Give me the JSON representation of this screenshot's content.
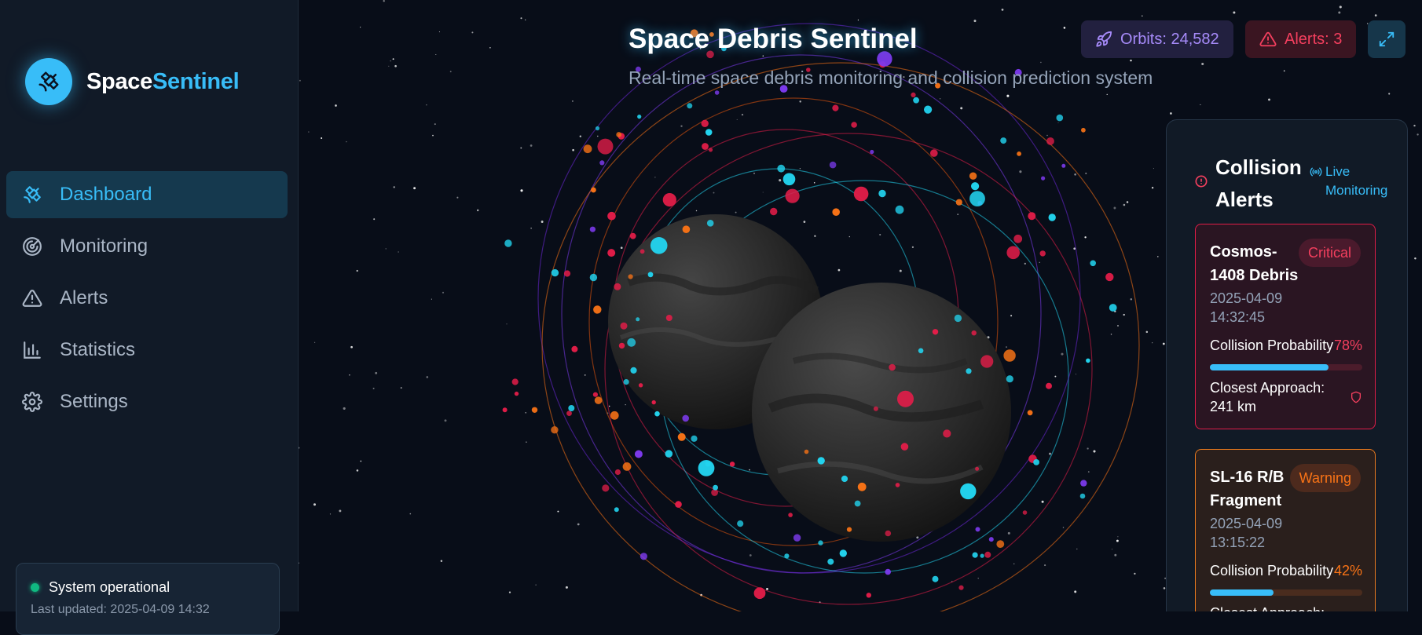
{
  "brand": {
    "name_part1": "Space",
    "name_part2": "Sentinel",
    "logo_icon": "satellite-icon"
  },
  "nav": [
    {
      "label": "Dashboard",
      "icon": "satellite-icon",
      "active": true
    },
    {
      "label": "Monitoring",
      "icon": "radar-icon",
      "active": false
    },
    {
      "label": "Alerts",
      "icon": "warning-icon",
      "active": false
    },
    {
      "label": "Statistics",
      "icon": "bar-chart-icon",
      "active": false
    },
    {
      "label": "Settings",
      "icon": "gear-icon",
      "active": false
    }
  ],
  "status": {
    "text": "System operational",
    "updated": "Last updated: 2025-04-09 14:32"
  },
  "header": {
    "title": "Space Debris Sentinel",
    "subtitle": "Real-time space debris monitoring and collision prediction system",
    "orbits_label": "Orbits: 24,582",
    "alerts_label": "Alerts: 3"
  },
  "panel": {
    "title": "Collision Alerts",
    "live_label": "Live Monitoring",
    "alerts": [
      {
        "name": "Cosmos-1408 Debris",
        "severity": "Critical",
        "time": "2025-04-09 14:32:45",
        "probability_label": "Collision Probability",
        "probability": "78%",
        "probability_value": 0.78,
        "approach": "Closest Approach: 241 km"
      },
      {
        "name": "SL-16 R/B Fragment",
        "severity": "Warning",
        "time": "2025-04-09 13:15:22",
        "probability_label": "Collision Probability",
        "probability": "42%",
        "probability_value": 0.42,
        "approach": "Closest Approach:"
      }
    ]
  },
  "colors": {
    "accent": "#38bdf8",
    "critical": "#f43f5e",
    "warning": "#f97316",
    "purple": "#a78bfa",
    "success": "#10b981",
    "background": "#080d18"
  }
}
